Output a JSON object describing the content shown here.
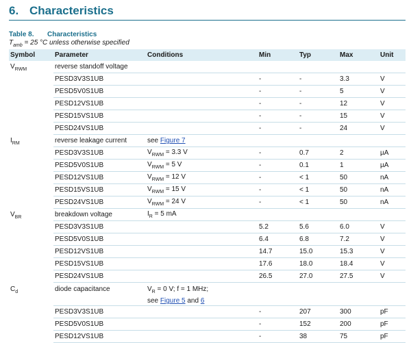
{
  "heading": {
    "number": "6.",
    "title": "Characteristics"
  },
  "table_caption": {
    "number": "Table 8.",
    "title": "Characteristics"
  },
  "condition": {
    "symbol": "T",
    "sub": "amb",
    "text": " = 25 °C unless otherwise specified"
  },
  "columns": [
    "Symbol",
    "Parameter",
    "Conditions",
    "Min",
    "Typ",
    "Max",
    "Unit"
  ],
  "groups": [
    {
      "symbol": "V",
      "symbol_sub": "RWM",
      "parameter": "reverse standoff voltage",
      "cond": {
        "pre": "",
        "sub": "",
        "post": ""
      },
      "rows": [
        {
          "part": "PESD3V3S1UB",
          "cond": {
            "pre": "",
            "sub": "",
            "post": ""
          },
          "min": "-",
          "typ": "-",
          "max": "3.3",
          "unit": "V"
        },
        {
          "part": "PESD5V0S1UB",
          "cond": {
            "pre": "",
            "sub": "",
            "post": ""
          },
          "min": "-",
          "typ": "-",
          "max": "5",
          "unit": "V"
        },
        {
          "part": "PESD12VS1UB",
          "cond": {
            "pre": "",
            "sub": "",
            "post": ""
          },
          "min": "-",
          "typ": "-",
          "max": "12",
          "unit": "V"
        },
        {
          "part": "PESD15VS1UB",
          "cond": {
            "pre": "",
            "sub": "",
            "post": ""
          },
          "min": "-",
          "typ": "-",
          "max": "15",
          "unit": "V"
        },
        {
          "part": "PESD24VS1UB",
          "cond": {
            "pre": "",
            "sub": "",
            "post": ""
          },
          "min": "-",
          "typ": "-",
          "max": "24",
          "unit": "V"
        }
      ]
    },
    {
      "symbol": "I",
      "symbol_sub": "RM",
      "parameter": "reverse leakage current",
      "cond": {
        "pre": "see ",
        "link": "Figure 7"
      },
      "rows": [
        {
          "part": "PESD3V3S1UB",
          "cond": {
            "pre": "V",
            "sub": "RWM",
            "post": " = 3.3 V"
          },
          "min": "-",
          "typ": "0.7",
          "max": "2",
          "unit": "µA"
        },
        {
          "part": "PESD5V0S1UB",
          "cond": {
            "pre": "V",
            "sub": "RWM",
            "post": " = 5 V"
          },
          "min": "-",
          "typ": "0.1",
          "max": "1",
          "unit": "µA"
        },
        {
          "part": "PESD12VS1UB",
          "cond": {
            "pre": "V",
            "sub": "RWM",
            "post": " = 12 V"
          },
          "min": "-",
          "typ": "< 1",
          "max": "50",
          "unit": "nA"
        },
        {
          "part": "PESD15VS1UB",
          "cond": {
            "pre": "V",
            "sub": "RWM",
            "post": " = 15 V"
          },
          "min": "-",
          "typ": "< 1",
          "max": "50",
          "unit": "nA"
        },
        {
          "part": "PESD24VS1UB",
          "cond": {
            "pre": "V",
            "sub": "RWM",
            "post": " = 24 V"
          },
          "min": "-",
          "typ": "< 1",
          "max": "50",
          "unit": "nA"
        }
      ]
    },
    {
      "symbol": "V",
      "symbol_sub": "BR",
      "parameter": "breakdown voltage",
      "cond": {
        "pre": "I",
        "sub": "R",
        "post": " = 5 mA"
      },
      "rows": [
        {
          "part": "PESD3V3S1UB",
          "cond": {
            "pre": "",
            "sub": "",
            "post": ""
          },
          "min": "5.2",
          "typ": "5.6",
          "max": "6.0",
          "unit": "V"
        },
        {
          "part": "PESD5V0S1UB",
          "cond": {
            "pre": "",
            "sub": "",
            "post": ""
          },
          "min": "6.4",
          "typ": "6.8",
          "max": "7.2",
          "unit": "V"
        },
        {
          "part": "PESD12VS1UB",
          "cond": {
            "pre": "",
            "sub": "",
            "post": ""
          },
          "min": "14.7",
          "typ": "15.0",
          "max": "15.3",
          "unit": "V"
        },
        {
          "part": "PESD15VS1UB",
          "cond": {
            "pre": "",
            "sub": "",
            "post": ""
          },
          "min": "17.6",
          "typ": "18.0",
          "max": "18.4",
          "unit": "V"
        },
        {
          "part": "PESD24VS1UB",
          "cond": {
            "pre": "",
            "sub": "",
            "post": ""
          },
          "min": "26.5",
          "typ": "27.0",
          "max": "27.5",
          "unit": "V"
        }
      ]
    },
    {
      "symbol": "C",
      "symbol_sub": "d",
      "parameter": "diode capacitance",
      "cond": {
        "pre": "V",
        "sub": "R",
        "post": " = 0 V; f = 1 MHz;",
        "line2_pre": "see ",
        "link1": "Figure 5",
        "mid": " and ",
        "link2": "6"
      },
      "rows": [
        {
          "part": "PESD3V3S1UB",
          "cond": {
            "pre": "",
            "sub": "",
            "post": ""
          },
          "min": "-",
          "typ": "207",
          "max": "300",
          "unit": "pF"
        },
        {
          "part": "PESD5V0S1UB",
          "cond": {
            "pre": "",
            "sub": "",
            "post": ""
          },
          "min": "-",
          "typ": "152",
          "max": "200",
          "unit": "pF"
        },
        {
          "part": "PESD12VS1UB",
          "cond": {
            "pre": "",
            "sub": "",
            "post": ""
          },
          "min": "-",
          "typ": "38",
          "max": "75",
          "unit": "pF"
        }
      ]
    }
  ]
}
